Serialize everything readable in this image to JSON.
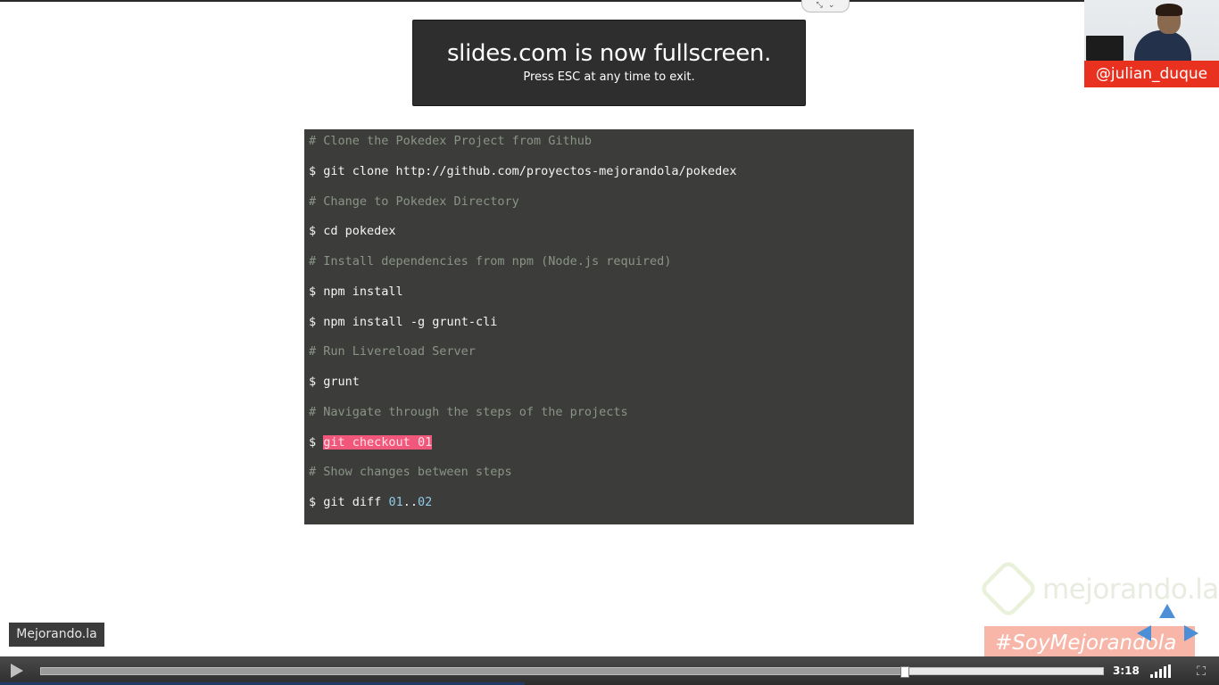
{
  "fullscreen_notice": {
    "title": "slides.com is now fullscreen.",
    "subtitle": "Press ESC at any time to exit."
  },
  "webcam": {
    "name_tag": "@julian_duque"
  },
  "code": {
    "lines": [
      {
        "type": "comment",
        "text": "# Clone the Pokedex Project from Github"
      },
      {
        "type": "cmd",
        "prompt": "$",
        "text": "git clone http://github.com/proyectos-mejorandola/pokedex"
      },
      {
        "type": "comment",
        "text": "# Change to Pokedex Directory"
      },
      {
        "type": "cmd",
        "prompt": "$",
        "text": "cd pokedex"
      },
      {
        "type": "comment",
        "text": "# Install dependencies from npm (Node.js required)"
      },
      {
        "type": "cmd",
        "prompt": "$",
        "text": "npm install"
      },
      {
        "type": "cmd",
        "prompt": "$",
        "text": "npm install -g grunt-cli"
      },
      {
        "type": "comment",
        "text": "# Run Livereload Server"
      },
      {
        "type": "cmd",
        "prompt": "$",
        "text": "grunt"
      },
      {
        "type": "comment",
        "text": "# Navigate through the steps of the projects"
      },
      {
        "type": "cmd",
        "prompt": "$",
        "text": "git checkout 01",
        "highlighted": true
      },
      {
        "type": "comment",
        "text": "# Show changes between steps"
      },
      {
        "type": "cmd",
        "prompt": "$",
        "text_before": "git diff ",
        "num_a": "01",
        "sep": "..",
        "num_b": "02"
      }
    ]
  },
  "branding": {
    "logo_text": "mejorando.la",
    "hashtag": "#SoyMejorandola",
    "channel_badge": "Mejorando.la"
  },
  "player": {
    "time": "3:18",
    "progress_fraction": 0.812,
    "icons": [
      "play-icon",
      "volume-icon",
      "fullscreen-icon"
    ]
  },
  "colors": {
    "code_bg": "#3c3d3a",
    "comment": "#8a9486",
    "highlight": "#f0577b",
    "number": "#8fc9e8",
    "name_tag_bg": "#e8321f",
    "nav_arrow": "#4d8fd6"
  }
}
